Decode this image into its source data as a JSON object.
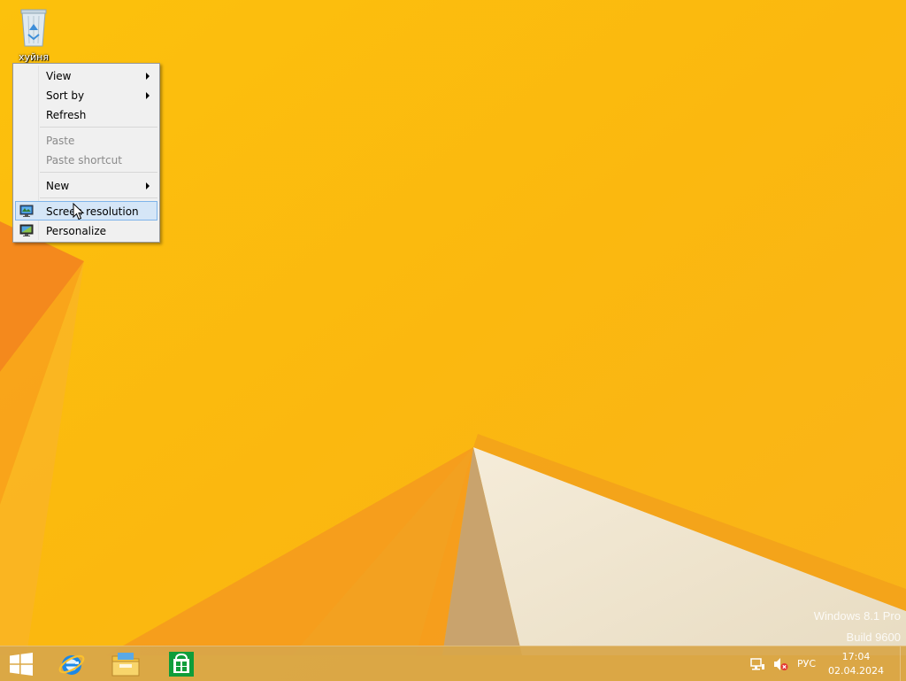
{
  "desktop": {
    "recycle_bin_label": "хуйня"
  },
  "context_menu": {
    "items": [
      {
        "label": "View",
        "submenu": true,
        "enabled": true
      },
      {
        "label": "Sort by",
        "submenu": true,
        "enabled": true
      },
      {
        "label": "Refresh",
        "submenu": false,
        "enabled": true
      },
      {
        "label": "Paste",
        "submenu": false,
        "enabled": false
      },
      {
        "label": "Paste shortcut",
        "submenu": false,
        "enabled": false
      },
      {
        "label": "New",
        "submenu": true,
        "enabled": true
      },
      {
        "label": "Screen resolution",
        "submenu": false,
        "enabled": true,
        "icon": "display-settings-icon",
        "highlighted": true
      },
      {
        "label": "Personalize",
        "submenu": false,
        "enabled": true,
        "icon": "personalize-icon"
      }
    ]
  },
  "watermark": {
    "line1": "Windows 8.1 Pro",
    "line2": "Build 9600"
  },
  "taskbar": {
    "pinned": [
      "start-button",
      "internet-explorer-icon",
      "file-explorer-icon",
      "store-icon"
    ],
    "tray": {
      "language": "РУС",
      "time": "17:04",
      "date": "02.04.2024"
    }
  },
  "colors": {
    "wallpaper_base": "#fbb80f",
    "taskbar": "#d8a64a",
    "menu_highlight": "#d5e6f7",
    "menu_highlight_border": "#7eb4ea"
  }
}
